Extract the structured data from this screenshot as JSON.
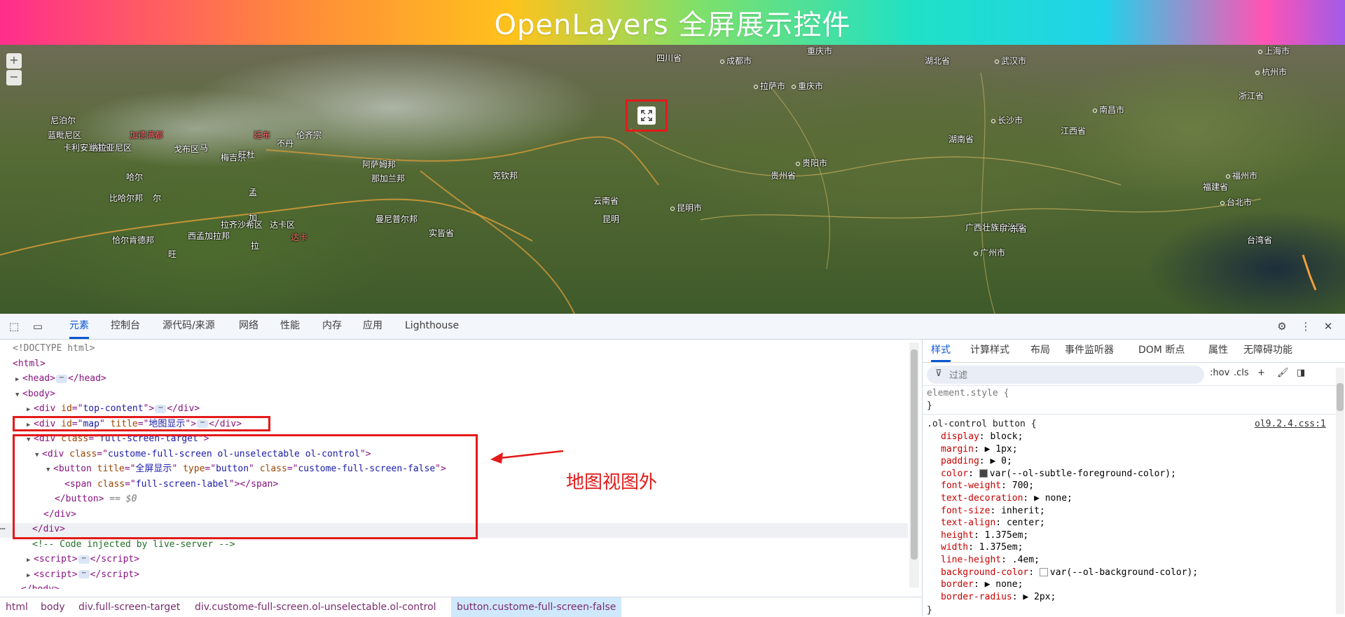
{
  "page": {
    "banner_title": "OpenLayers 全屏展示控件"
  },
  "map": {
    "zoom_in": "+",
    "zoom_out": "−",
    "labels": [
      {
        "text": "四川省",
        "cls": ""
      },
      {
        "text": "成都市",
        "cls": "dot"
      },
      {
        "text": "重庆市",
        "cls": ""
      },
      {
        "text": "湖北省",
        "cls": ""
      },
      {
        "text": "武汉市",
        "cls": "dot"
      },
      {
        "text": "上海市",
        "cls": "dot"
      },
      {
        "text": "杭州市",
        "cls": "dot"
      },
      {
        "text": "重庆市",
        "cls": "dot"
      },
      {
        "text": "浙江省",
        "cls": ""
      },
      {
        "text": "拉萨市",
        "cls": "dot"
      },
      {
        "text": "尼泊尔",
        "cls": ""
      },
      {
        "text": "蓝毗尼区",
        "cls": ""
      },
      {
        "text": "加德满都",
        "cls": "red"
      },
      {
        "text": "廷布",
        "cls": "red"
      },
      {
        "text": "伦齐宗",
        "cls": ""
      },
      {
        "text": "不丹",
        "cls": ""
      },
      {
        "text": "长沙市",
        "cls": "dot"
      },
      {
        "text": "南昌市",
        "cls": "dot"
      },
      {
        "text": "湖南省",
        "cls": ""
      },
      {
        "text": "江西省",
        "cls": ""
      },
      {
        "text": "贵阳市",
        "cls": "dot"
      },
      {
        "text": "贵州省",
        "cls": ""
      },
      {
        "text": "阿萨姆邦",
        "cls": ""
      },
      {
        "text": "那加兰邦",
        "cls": ""
      },
      {
        "text": "克钦邦",
        "cls": ""
      },
      {
        "text": "福州市",
        "cls": "dot"
      },
      {
        "text": "福建省",
        "cls": ""
      },
      {
        "text": "云南省",
        "cls": ""
      },
      {
        "text": "昆明市",
        "cls": "dot"
      },
      {
        "text": "比哈尔邦",
        "cls": ""
      },
      {
        "text": "拉齐沙希区",
        "cls": ""
      },
      {
        "text": "曼尼普尔邦",
        "cls": ""
      },
      {
        "text": "实皆省",
        "cls": ""
      },
      {
        "text": "台北市",
        "cls": "dot"
      },
      {
        "text": "恰尔肯德邦",
        "cls": ""
      },
      {
        "text": "西孟加拉邦",
        "cls": ""
      },
      {
        "text": "达卡区",
        "cls": ""
      },
      {
        "text": "达卡",
        "cls": "red"
      },
      {
        "text": "广西壮族自治区",
        "cls": ""
      },
      {
        "text": "广东省",
        "cls": ""
      },
      {
        "text": "广州市",
        "cls": "dot"
      },
      {
        "text": "台湾省",
        "cls": ""
      },
      {
        "text": "孟",
        "cls": ""
      },
      {
        "text": "加",
        "cls": ""
      },
      {
        "text": "拉",
        "cls": ""
      },
      {
        "text": "卡利安达基省",
        "cls": ""
      },
      {
        "text": "戈布区",
        "cls": ""
      },
      {
        "text": "马",
        "cls": ""
      },
      {
        "text": "尔",
        "cls": ""
      },
      {
        "text": "旺",
        "cls": ""
      },
      {
        "text": "哈尔",
        "cls": ""
      },
      {
        "text": "纳拉亚尼区",
        "cls": ""
      },
      {
        "text": "梅吉宗",
        "cls": ""
      },
      {
        "text": "旺杜",
        "cls": ""
      },
      {
        "text": "昆明",
        "cls": ""
      }
    ]
  },
  "devtools": {
    "tabs": [
      "元素",
      "控制台",
      "源代码/来源",
      "网络",
      "性能",
      "内存",
      "应用",
      "Lighthouse"
    ],
    "elements": {
      "lines": [
        {
          "html": "<span class=\"gray\">&lt;!DOCTYPE html&gt;</span>"
        },
        {
          "html": "<span class=\"tag\">&lt;html&gt;</span>"
        },
        {
          "html": "<span class=\"arrow\">▶</span><span class=\"tag\">&lt;head&gt;</span><span class=\"ell\">⋯</span><span class=\"tag\">&lt;/head&gt;</span>"
        },
        {
          "html": "<span class=\"arrow\">▼</span><span class=\"tag\">&lt;body&gt;</span>"
        },
        {
          "html": "<span class=\"arrow\">▶</span><span class=\"tag\">&lt;div </span><span class=\"attr\">id</span><span class=\"tag\">=\"</span><span class=\"val\">top-content</span><span class=\"tag\">\"&gt;</span><span class=\"ell\">⋯</span><span class=\"tag\">&lt;/div&gt;</span>"
        },
        {
          "html": "<span class=\"arrow\">▶</span><span class=\"tag\">&lt;div </span><span class=\"attr\">id</span><span class=\"tag\">=\"</span><span class=\"val\">map</span><span class=\"tag\">\" </span><span class=\"attr\">title</span><span class=\"tag\">=\"</span><span class=\"val\">地图显示</span><span class=\"tag\">\"&gt;</span><span class=\"ell\">⋯</span><span class=\"tag\">&lt;/div&gt;</span>"
        },
        {
          "html": "<span class=\"arrow\">▼</span><span class=\"tag\">&lt;div </span><span class=\"attr\">class</span><span class=\"tag\">=\"</span><span class=\"val\">full-screen-target</span><span class=\"tag\">\"&gt;</span>"
        },
        {
          "html": "<span class=\"arrow\">▼</span><span class=\"tag\">&lt;div </span><span class=\"attr\">class</span><span class=\"tag\">=\"</span><span class=\"val\">custome-full-screen ol-unselectable ol-control</span><span class=\"tag\">\"&gt;</span>"
        },
        {
          "html": "<span class=\"arrow\">▼</span><span class=\"tag\">&lt;button </span><span class=\"attr\">title</span><span class=\"tag\">=\"</span><span class=\"val\">全屏显示</span><span class=\"tag\">\" </span><span class=\"attr\">type</span><span class=\"tag\">=\"</span><span class=\"val\">button</span><span class=\"tag\">\" </span><span class=\"attr\">class</span><span class=\"tag\">=\"</span><span class=\"val\">custome-full-screen-false</span><span class=\"tag\">\"&gt;</span>"
        },
        {
          "html": "<span class=\"tag\">&lt;span </span><span class=\"attr\">class</span><span class=\"tag\">=\"</span><span class=\"val\">full-screen-label</span><span class=\"tag\">\"&gt;&lt;/span&gt;</span>"
        },
        {
          "html": "<span class=\"tag\">&lt;/button&gt;</span> <span class=\"gray\">== <i>$0</i></span>"
        },
        {
          "html": "<span class=\"tag\">&lt;/div&gt;</span>"
        },
        {
          "html": "<span class=\"tag\">&lt;/div&gt;</span>"
        },
        {
          "html": "<span class=\"comment\">&lt;!-- Code injected by live-server --&gt;</span>"
        },
        {
          "html": "<span class=\"arrow\">▶</span><span class=\"tag\">&lt;script&gt;</span><span class=\"ell\">⋯</span><span class=\"tag\">&lt;/script&gt;</span>"
        },
        {
          "html": "<span class=\"arrow\">▶</span><span class=\"tag\">&lt;script&gt;</span><span class=\"ell\">⋯</span><span class=\"tag\">&lt;/script&gt;</span>"
        },
        {
          "html": "<span class=\"tag\">&lt;/body&gt;</span>"
        }
      ]
    },
    "annotation": "地图视图外",
    "breadcrumb": [
      "html",
      "body",
      "div.full-screen-target",
      "div.custome-full-screen.ol-unselectable.ol-control",
      "button.custome-full-screen-false"
    ],
    "styles_tabs": [
      "样式",
      "计算样式",
      "布局",
      "事件监听器",
      "DOM 断点",
      "属性",
      "无障碍功能"
    ],
    "filter_placeholder": "过滤",
    "filter_tools": [
      ":hov",
      ".cls",
      "+",
      "🖌",
      "◨"
    ],
    "element_style_selector": "element.style {",
    "element_style_close": "}",
    "rule_selector": ".ol-control button {",
    "rule_source": "ol9.2.4.css:1",
    "rule_props": [
      {
        "p": "display",
        "v": "block"
      },
      {
        "p": "margin",
        "v": "▶ 1px"
      },
      {
        "p": "padding",
        "v": "▶ 0"
      },
      {
        "p": "color",
        "v": "var(--ol-subtle-foreground-color)",
        "swatch": "#444444"
      },
      {
        "p": "font-weight",
        "v": "700"
      },
      {
        "p": "text-decoration",
        "v": "▶ none"
      },
      {
        "p": "font-size",
        "v": "inherit"
      },
      {
        "p": "text-align",
        "v": "center"
      },
      {
        "p": "height",
        "v": "1.375em"
      },
      {
        "p": "width",
        "v": "1.375em"
      },
      {
        "p": "line-height",
        "v": ".4em"
      },
      {
        "p": "background-color",
        "v": "var(--ol-background-color)",
        "swatch": "#ffffff"
      },
      {
        "p": "border",
        "v": "▶ none"
      },
      {
        "p": "border-radius",
        "v": "▶ 2px"
      }
    ],
    "rule_close": "}"
  }
}
